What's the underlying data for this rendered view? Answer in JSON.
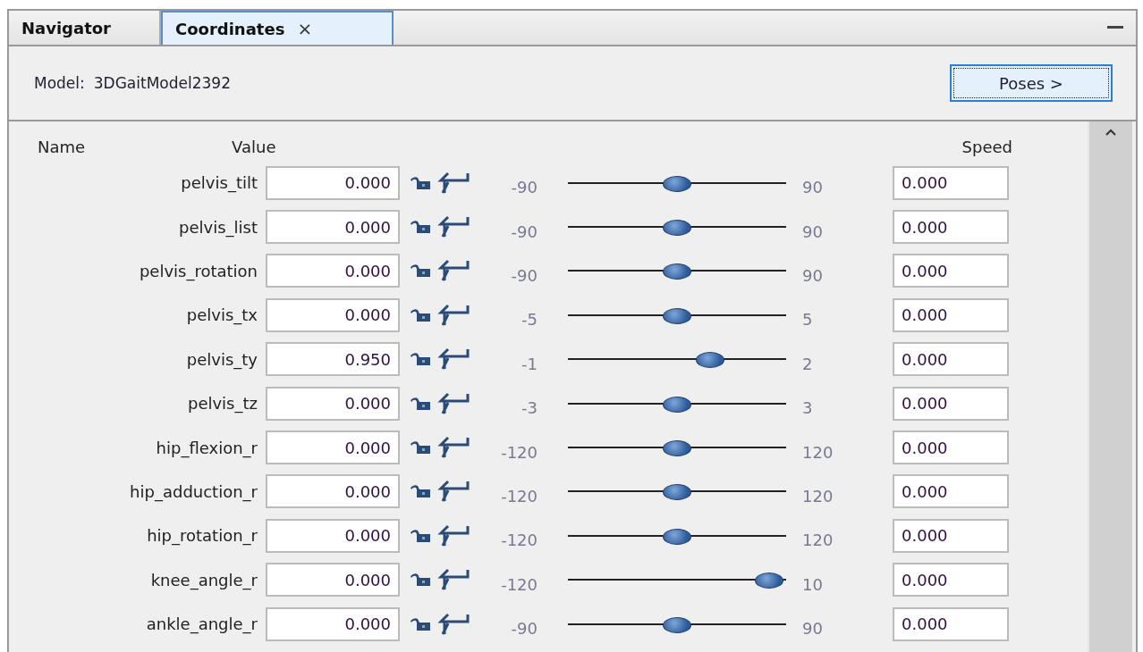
{
  "tabs": [
    {
      "label": "Navigator",
      "selected": false
    },
    {
      "label": "Coordinates",
      "selected": true,
      "close": "×"
    }
  ],
  "model": {
    "label": "Model:",
    "name": "3DGaitModel2392"
  },
  "poses_button": "Poses >",
  "columns": {
    "name": "Name",
    "value": "Value",
    "speed": "Speed"
  },
  "rows": [
    {
      "name": "pelvis_tilt",
      "value": "0.000",
      "min": "-90",
      "max": "90",
      "level": 0.5,
      "speed": "0.000"
    },
    {
      "name": "pelvis_list",
      "value": "0.000",
      "min": "-90",
      "max": "90",
      "level": 0.5,
      "speed": "0.000"
    },
    {
      "name": "pelvis_rotation",
      "value": "0.000",
      "min": "-90",
      "max": "90",
      "level": 0.5,
      "speed": "0.000"
    },
    {
      "name": "pelvis_tx",
      "value": "0.000",
      "min": "-5",
      "max": "5",
      "level": 0.5,
      "speed": "0.000"
    },
    {
      "name": "pelvis_ty",
      "value": "0.950",
      "min": "-1",
      "max": "2",
      "level": 0.65,
      "speed": "0.000"
    },
    {
      "name": "pelvis_tz",
      "value": "0.000",
      "min": "-3",
      "max": "3",
      "level": 0.5,
      "speed": "0.000"
    },
    {
      "name": "hip_flexion_r",
      "value": "0.000",
      "min": "-120",
      "max": "120",
      "level": 0.5,
      "speed": "0.000"
    },
    {
      "name": "hip_adduction_r",
      "value": "0.000",
      "min": "-120",
      "max": "120",
      "level": 0.5,
      "speed": "0.000"
    },
    {
      "name": "hip_rotation_r",
      "value": "0.000",
      "min": "-120",
      "max": "120",
      "level": 0.5,
      "speed": "0.000"
    },
    {
      "name": "knee_angle_r",
      "value": "0.000",
      "min": "-120",
      "max": "10",
      "level": 0.923,
      "speed": "0.000"
    },
    {
      "name": "ankle_angle_r",
      "value": "0.000",
      "min": "-90",
      "max": "90",
      "level": 0.5,
      "speed": "0.000"
    }
  ]
}
